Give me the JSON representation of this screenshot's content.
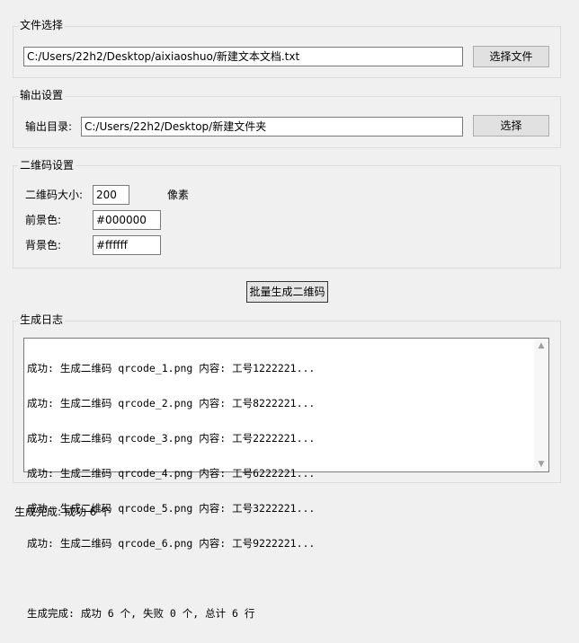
{
  "file_select": {
    "title": "文件选择",
    "path": "C:/Users/22h2/Desktop/aixiaoshuo/新建文本文档.txt",
    "button": "选择文件"
  },
  "output_settings": {
    "title": "输出设置",
    "dir_label": "输出目录:",
    "dir_value": "C:/Users/22h2/Desktop/新建文件夹",
    "button": "选择"
  },
  "qr_settings": {
    "title": "二维码设置",
    "size_label": "二维码大小:",
    "size_value": "200",
    "size_unit": "像素",
    "fg_label": "前景色:",
    "fg_value": "#000000",
    "bg_label": "背景色:",
    "bg_value": "#ffffff"
  },
  "generate_button": "批量生成二维码",
  "log": {
    "title": "生成日志",
    "lines": [
      "成功: 生成二维码 qrcode_1.png 内容: 工号1222221...",
      "成功: 生成二维码 qrcode_2.png 内容: 工号8222221...",
      "成功: 生成二维码 qrcode_3.png 内容: 工号2222221...",
      "成功: 生成二维码 qrcode_4.png 内容: 工号6222221...",
      "成功: 生成二维码 qrcode_5.png 内容: 工号3222221...",
      "成功: 生成二维码 qrcode_6.png 内容: 工号9222221..."
    ],
    "summary": "生成完成: 成功 6 个, 失败 0 个, 总计 6 行"
  },
  "status_bar": "生成完成: 成功 6 个",
  "icons": {
    "scroll_up": "triangle-up",
    "scroll_down": "triangle-down"
  }
}
